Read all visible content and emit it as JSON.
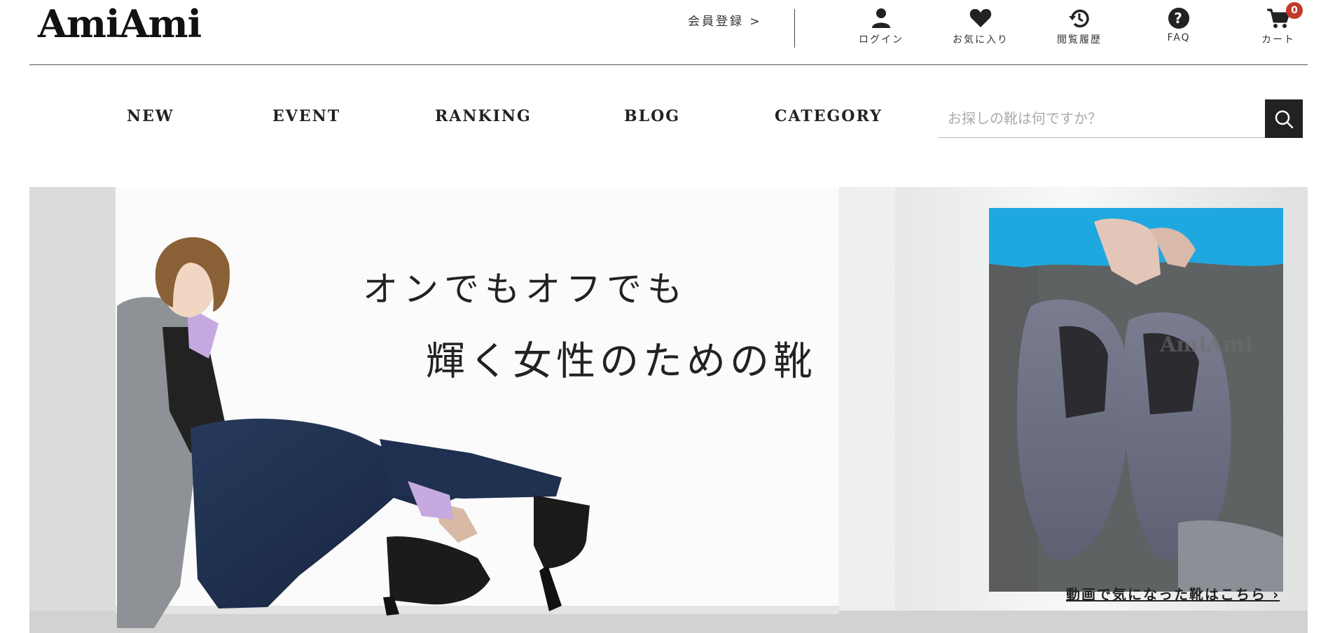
{
  "header": {
    "logo": "AmiAmi",
    "register_link": "会員登録 >",
    "icons": [
      {
        "icon": "user-icon",
        "label": "ログイン"
      },
      {
        "icon": "heart-icon",
        "label": "お気に入り"
      },
      {
        "icon": "history-icon",
        "label": "閲覧履歴"
      },
      {
        "icon": "question-icon",
        "label": "FAQ"
      },
      {
        "icon": "cart-icon",
        "label": "カート",
        "badge": "0"
      }
    ]
  },
  "nav": {
    "items": [
      "NEW",
      "EVENT",
      "RANKING",
      "BLOG",
      "CATEGORY"
    ]
  },
  "search": {
    "placeholder": "お探しの靴は何ですか？",
    "value": ""
  },
  "hero": {
    "line1": "オンでもオフでも",
    "line2": "輝く女性のための靴",
    "video_link": "動画で気になった靴はこちら ›",
    "watermark": "AmiAmi"
  },
  "colors": {
    "accent": "#222222",
    "badge": "#c0392b",
    "fur": "#6f7185",
    "sweater": "#1fa8e0"
  }
}
